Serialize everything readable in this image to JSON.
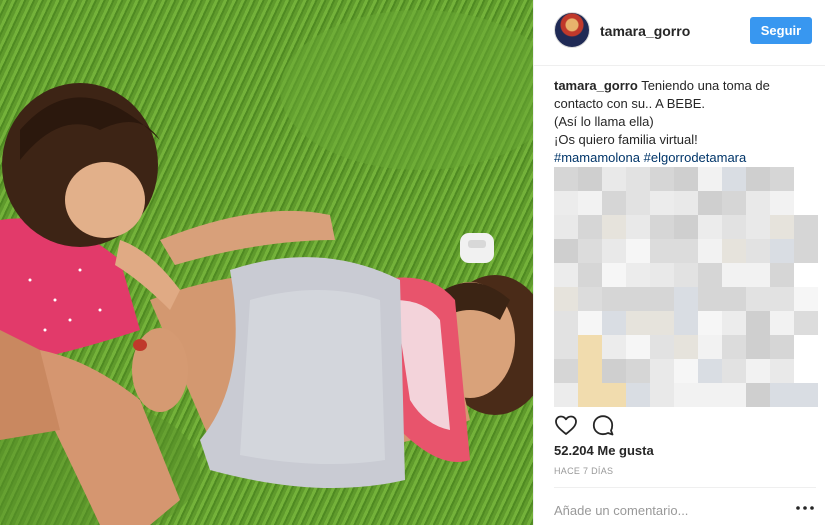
{
  "post": {
    "username": "tamara_gorro",
    "follow_label": "Seguir"
  },
  "caption": {
    "username": "tamara_gorro",
    "line1": "Teniendo una toma de contacto con su.. A BEBE.",
    "line2": "(Así lo llama ella)",
    "line3": "¡Os quiero familia virtual!",
    "hashtag1": "#mamamolona",
    "hashtag2": "#elgorrodetamara"
  },
  "stats": {
    "likes": "52.204 Me gusta",
    "time": "HACE 7 DÍAS"
  },
  "comment_box": {
    "placeholder": "Añade un comentario..."
  },
  "icons": {
    "like": "heart-icon",
    "comment": "comment-icon",
    "more": "more-options-icon"
  },
  "colors": {
    "follow_button": "#3897f0",
    "hashtag": "#003569",
    "muted_text": "#999999"
  }
}
